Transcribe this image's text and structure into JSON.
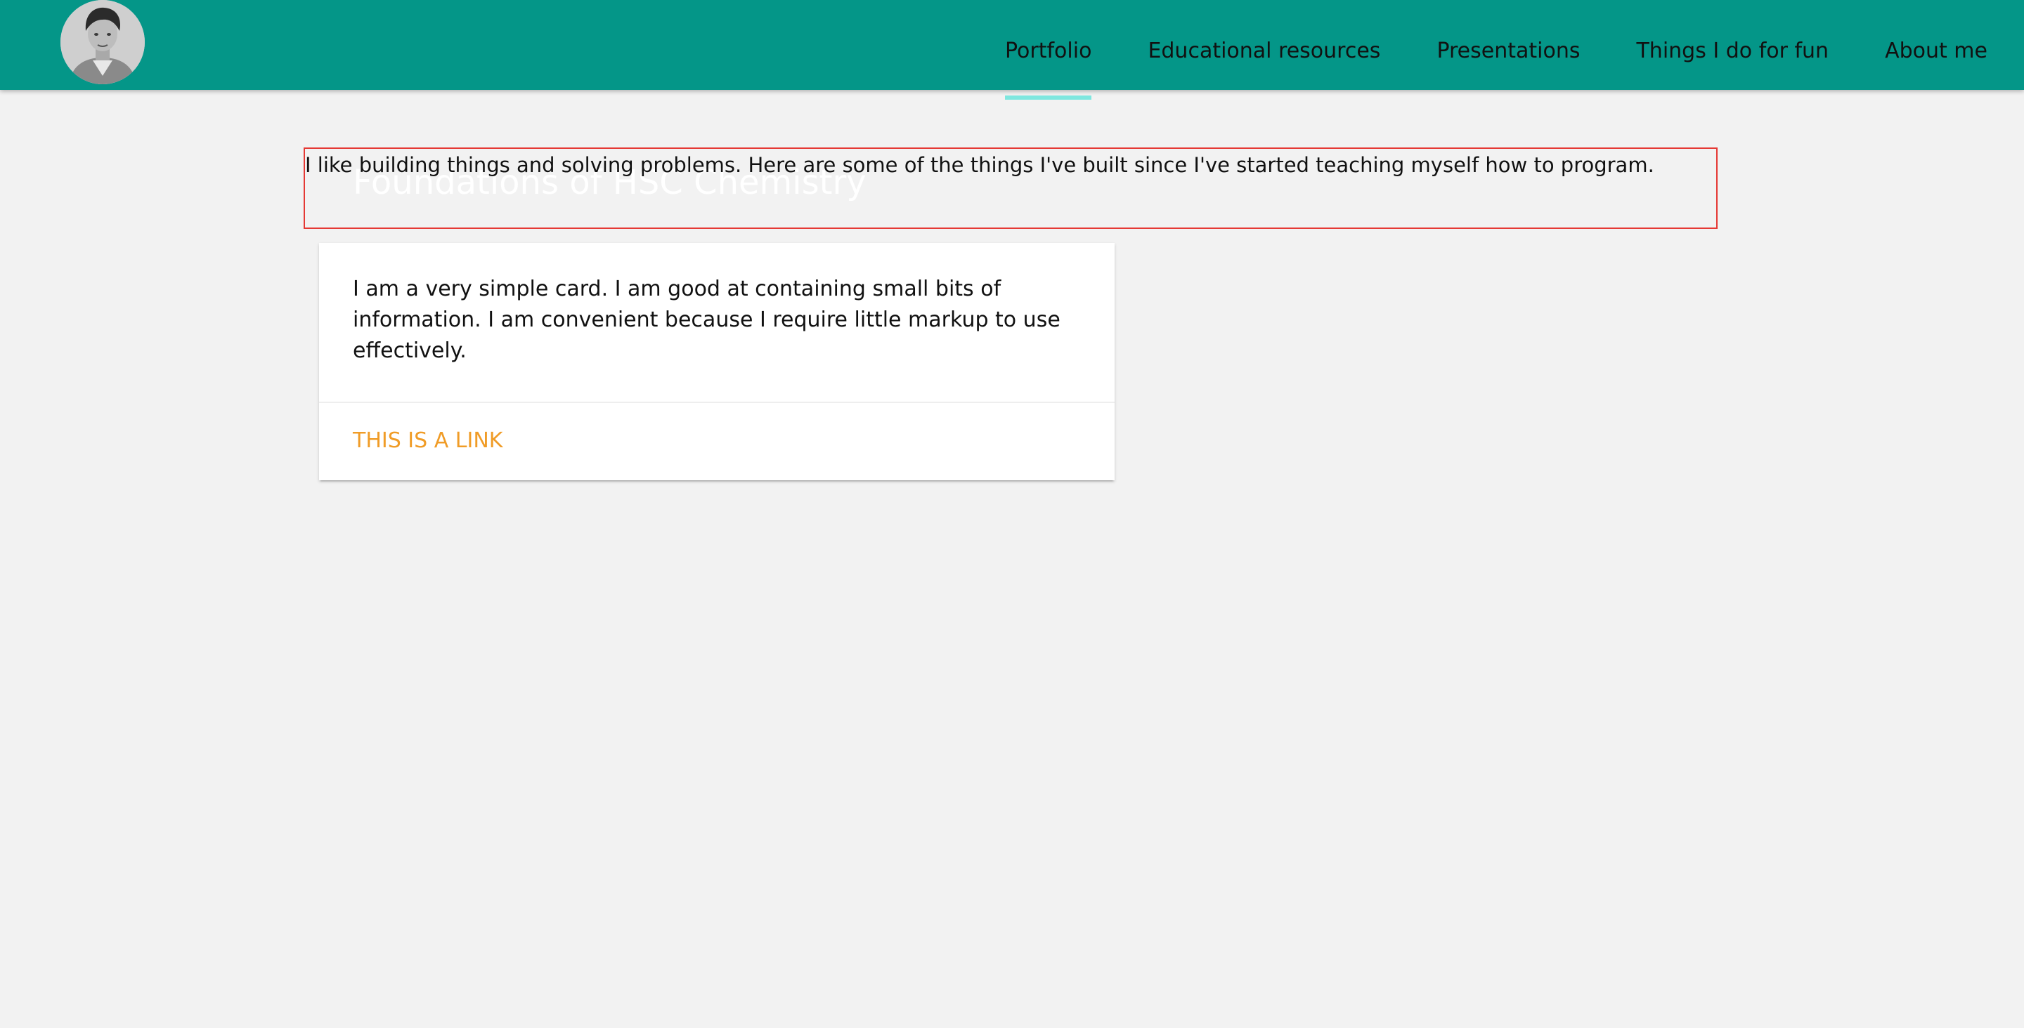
{
  "header": {
    "nav": [
      {
        "label": "Portfolio",
        "active": true
      },
      {
        "label": "Educational resources"
      },
      {
        "label": "Presentations"
      },
      {
        "label": "Things I do for fun"
      },
      {
        "label": "About me"
      }
    ]
  },
  "main": {
    "intro": "I like building things and solving problems. Here are some of the things I've built since I've started teaching myself how to program.",
    "card": {
      "title": "Foundations of HSC Chemistry",
      "text": "I am a very simple card. I am good at containing small bits of information. I am convenient because I require little markup to use effectively.",
      "link": "THIS IS A LINK"
    }
  },
  "colors": {
    "navbar": "#049688",
    "active_indicator": "#7fe7df",
    "link": "#f09c27",
    "background": "#f2f2f2",
    "highlight_border": "#e53935"
  }
}
